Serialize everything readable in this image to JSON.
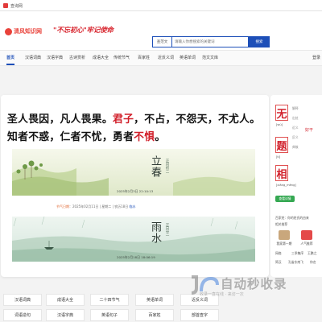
{
  "browser": {
    "tab_title": "查询网"
  },
  "header": {
    "logo_text": "清风知识网",
    "slogan": "\"不忘初心\"牢记使命",
    "search": {
      "type_label": "查范文",
      "placeholder": "请输入你想搜索的关键词",
      "button": "搜索"
    }
  },
  "nav": [
    "首页",
    "汉语词典",
    "汉语字典",
    "古诗赏析",
    "成语大全",
    "传统节气",
    "百家姓",
    "近反义词",
    "英语单词",
    "范文文库",
    "登录"
  ],
  "quote": {
    "parts": [
      {
        "text": "圣人畏因，凡人畏果。",
        "hl": false
      },
      {
        "text": "君子",
        "hl": true
      },
      {
        "text": "，不占，不怨天，不尤人。知者不惑，仁者不忧，勇者",
        "hl": false
      },
      {
        "text": "不惧",
        "hl": true
      },
      {
        "text": "。",
        "hl": false
      }
    ]
  },
  "solar_terms": [
    {
      "name": "立春",
      "calendar": "正月初二",
      "date": "2025年2月3日 22:10:13",
      "info": {
        "label": "节气日期",
        "text": "：2025年02月11日 | 星期二 | 农历18日",
        "link": "临水"
      }
    },
    {
      "name": "雨水",
      "calendar": "正月廿一",
      "date": "2025年2月18日 18:06:19"
    }
  ],
  "idiom": {
    "chars": [
      "无",
      "题",
      "相"
    ],
    "pinyin": [
      "[wú]",
      "[tí]",
      "[xiāng_mèng]"
    ],
    "meta": [
      "解释",
      "出处",
      "近义",
      "反义",
      "典故"
    ],
    "button": "查看详情",
    "related_title": "百家姓：你的姓氏的由来",
    "related_sub": "相关推荐",
    "recommend": [
      {
        "label": "我家第一期",
        "color": "#c9a77c"
      },
      {
        "label": "人气推荐",
        "color": "#e44a4a"
      }
    ],
    "list": [
      "网络",
      "三季集序",
      "王鹏之",
      "简汉",
      "孔雀东南飞",
      "你名"
    ],
    "side_right": "好干"
  },
  "bottom_links": [
    "汉语词典",
    "成语大全",
    "二十四节气",
    "英语单词",
    "近反义词",
    "词语造句",
    "汉语字典",
    "英语句子",
    "百家姓",
    "部首查字"
  ],
  "watermark": {
    "main": "自动秒收录",
    "sub": "收录一直在线 · 来访一次"
  },
  "colors": {
    "brand": "#e9423a",
    "accent": "#1d4fb8",
    "highlight": "#d11f2a"
  }
}
